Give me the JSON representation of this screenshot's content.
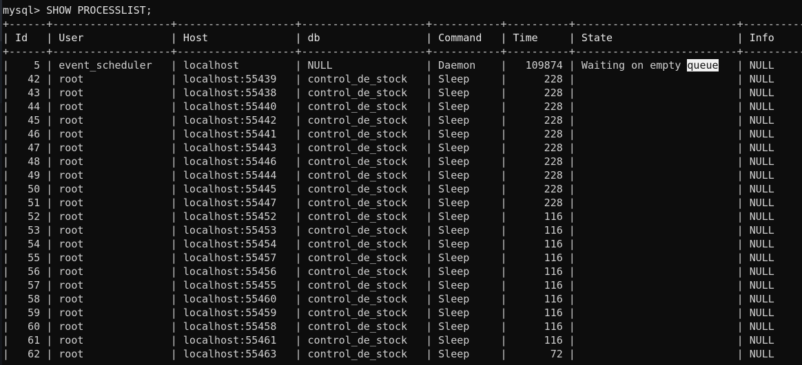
{
  "terminal": {
    "prompt": "mysql>",
    "command": "SHOW PROCESSLIST;",
    "prompt_line": "mysql> SHOW PROCESSLIST;",
    "background_color": "#0d0d0d",
    "text_color": "#d0d0d0",
    "selection_background_color": "#f2f2f2",
    "selection_text_color": "#101010",
    "selected_text": "queue"
  },
  "table": {
    "border_rule": "+----+-----------------+-----------------+------------------+---------+--------+------------------------+------------------+",
    "columns": [
      {
        "name": "Id",
        "width": 4,
        "align": "right"
      },
      {
        "name": "User",
        "width": 17,
        "align": "left"
      },
      {
        "name": "Host",
        "width": 17,
        "align": "left"
      },
      {
        "name": "db",
        "width": 18,
        "align": "left"
      },
      {
        "name": "Command",
        "width": 9,
        "align": "left"
      },
      {
        "name": "Time",
        "width": 8,
        "align": "right"
      },
      {
        "name": "State",
        "width": 24,
        "align": "left"
      },
      {
        "name": "Info",
        "width": 18,
        "align": "left"
      }
    ],
    "rows": [
      {
        "Id": "5",
        "User": "event_scheduler",
        "Host": "localhost",
        "db": "NULL",
        "Command": "Daemon",
        "Time": "109874",
        "State": "Waiting on empty queue",
        "Info": "NULL"
      },
      {
        "Id": "42",
        "User": "root",
        "Host": "localhost:55439",
        "db": "control_de_stock",
        "Command": "Sleep",
        "Time": "228",
        "State": "",
        "Info": "NULL"
      },
      {
        "Id": "43",
        "User": "root",
        "Host": "localhost:55438",
        "db": "control_de_stock",
        "Command": "Sleep",
        "Time": "228",
        "State": "",
        "Info": "NULL"
      },
      {
        "Id": "44",
        "User": "root",
        "Host": "localhost:55440",
        "db": "control_de_stock",
        "Command": "Sleep",
        "Time": "228",
        "State": "",
        "Info": "NULL"
      },
      {
        "Id": "45",
        "User": "root",
        "Host": "localhost:55442",
        "db": "control_de_stock",
        "Command": "Sleep",
        "Time": "228",
        "State": "",
        "Info": "NULL"
      },
      {
        "Id": "46",
        "User": "root",
        "Host": "localhost:55441",
        "db": "control_de_stock",
        "Command": "Sleep",
        "Time": "228",
        "State": "",
        "Info": "NULL"
      },
      {
        "Id": "47",
        "User": "root",
        "Host": "localhost:55443",
        "db": "control_de_stock",
        "Command": "Sleep",
        "Time": "228",
        "State": "",
        "Info": "NULL"
      },
      {
        "Id": "48",
        "User": "root",
        "Host": "localhost:55446",
        "db": "control_de_stock",
        "Command": "Sleep",
        "Time": "228",
        "State": "",
        "Info": "NULL"
      },
      {
        "Id": "49",
        "User": "root",
        "Host": "localhost:55444",
        "db": "control_de_stock",
        "Command": "Sleep",
        "Time": "228",
        "State": "",
        "Info": "NULL"
      },
      {
        "Id": "50",
        "User": "root",
        "Host": "localhost:55445",
        "db": "control_de_stock",
        "Command": "Sleep",
        "Time": "228",
        "State": "",
        "Info": "NULL"
      },
      {
        "Id": "51",
        "User": "root",
        "Host": "localhost:55447",
        "db": "control_de_stock",
        "Command": "Sleep",
        "Time": "228",
        "State": "",
        "Info": "NULL"
      },
      {
        "Id": "52",
        "User": "root",
        "Host": "localhost:55452",
        "db": "control_de_stock",
        "Command": "Sleep",
        "Time": "116",
        "State": "",
        "Info": "NULL"
      },
      {
        "Id": "53",
        "User": "root",
        "Host": "localhost:55453",
        "db": "control_de_stock",
        "Command": "Sleep",
        "Time": "116",
        "State": "",
        "Info": "NULL"
      },
      {
        "Id": "54",
        "User": "root",
        "Host": "localhost:55454",
        "db": "control_de_stock",
        "Command": "Sleep",
        "Time": "116",
        "State": "",
        "Info": "NULL"
      },
      {
        "Id": "55",
        "User": "root",
        "Host": "localhost:55457",
        "db": "control_de_stock",
        "Command": "Sleep",
        "Time": "116",
        "State": "",
        "Info": "NULL"
      },
      {
        "Id": "56",
        "User": "root",
        "Host": "localhost:55456",
        "db": "control_de_stock",
        "Command": "Sleep",
        "Time": "116",
        "State": "",
        "Info": "NULL"
      },
      {
        "Id": "57",
        "User": "root",
        "Host": "localhost:55455",
        "db": "control_de_stock",
        "Command": "Sleep",
        "Time": "116",
        "State": "",
        "Info": "NULL"
      },
      {
        "Id": "58",
        "User": "root",
        "Host": "localhost:55460",
        "db": "control_de_stock",
        "Command": "Sleep",
        "Time": "116",
        "State": "",
        "Info": "NULL"
      },
      {
        "Id": "59",
        "User": "root",
        "Host": "localhost:55459",
        "db": "control_de_stock",
        "Command": "Sleep",
        "Time": "116",
        "State": "",
        "Info": "NULL"
      },
      {
        "Id": "60",
        "User": "root",
        "Host": "localhost:55458",
        "db": "control_de_stock",
        "Command": "Sleep",
        "Time": "116",
        "State": "",
        "Info": "NULL"
      },
      {
        "Id": "61",
        "User": "root",
        "Host": "localhost:55461",
        "db": "control_de_stock",
        "Command": "Sleep",
        "Time": "116",
        "State": "",
        "Info": "NULL"
      },
      {
        "Id": "62",
        "User": "root",
        "Host": "localhost:55463",
        "db": "control_de_stock",
        "Command": "Sleep",
        "Time": "72",
        "State": "",
        "Info": "NULL"
      }
    ]
  }
}
